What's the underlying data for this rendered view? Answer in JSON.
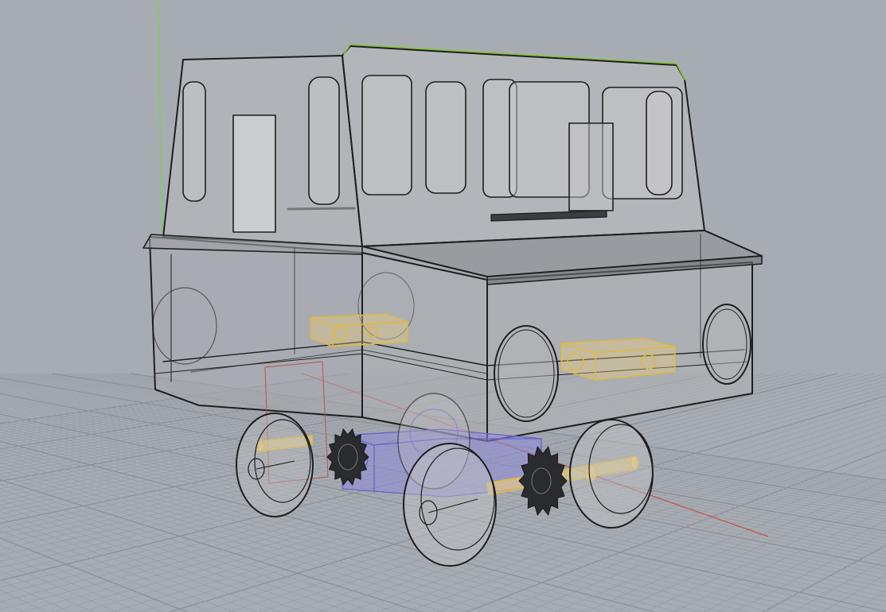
{
  "viewport": {
    "display_mode": "xray",
    "background_color": "#a7acb3",
    "grid_color": "#9a9fa6",
    "grid_major_color": "#8c9198",
    "x_axis_color": "#c0504d",
    "y_axis_color": "#7ad43b",
    "selection_color": "#86c43a"
  },
  "model": {
    "body_fill": "#b7b8ba",
    "edge_color": "#1e1e1e",
    "motor_color": "#e8c14e",
    "gearbox_color": "#8f8ad8",
    "axle_color": "#e2b93a"
  }
}
